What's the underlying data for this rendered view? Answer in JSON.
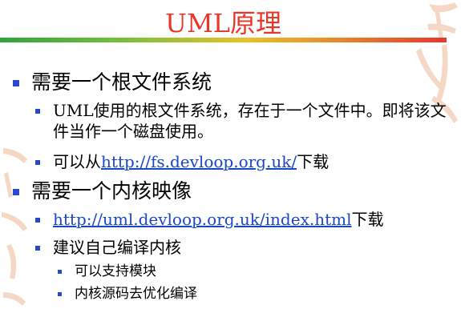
{
  "title": "UML原理",
  "items": [
    {
      "level": 1,
      "text": "需要一个根文件系统"
    },
    {
      "level": 2,
      "text": "UML使用的根文件系统，存在于一个文件中。即将该文件当作一个磁盘使用。"
    },
    {
      "level": 2,
      "prefix": "可以从",
      "link": "http://fs.devloop.org.uk/",
      "suffix": "下载"
    },
    {
      "level": 1,
      "text": "需要一个内核映像"
    },
    {
      "level": 2,
      "link": "http://uml.devloop.org.uk/index.html",
      "suffix": "下载"
    },
    {
      "level": 2,
      "text": "建议自己编译内核"
    },
    {
      "level": 3,
      "text": "可以支持模块"
    },
    {
      "level": 3,
      "text": "内核源码去优化编译"
    }
  ],
  "colors": {
    "title": "#e8372a",
    "bullet": "#2a49c9",
    "link": "#1a46c8"
  }
}
